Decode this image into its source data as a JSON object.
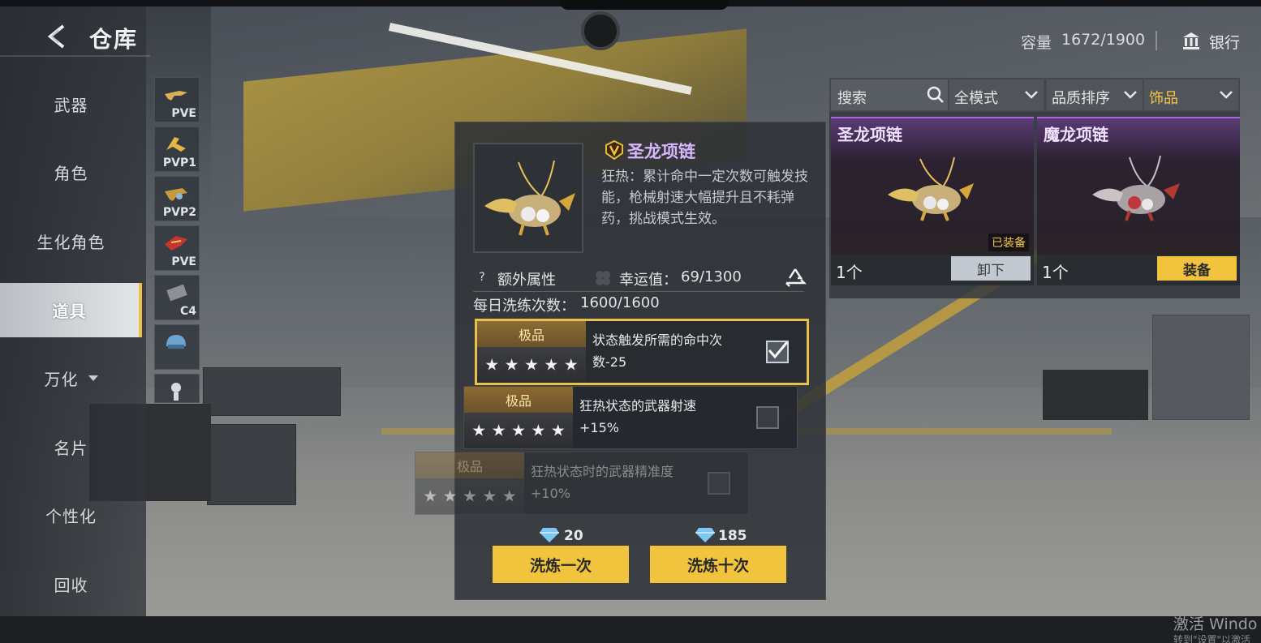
{
  "header": {
    "title": "仓库",
    "capacity_label": "容量",
    "capacity_value": "1672/1900",
    "bank_label": "银行"
  },
  "menu": {
    "items": [
      {
        "label": "武器"
      },
      {
        "label": "角色"
      },
      {
        "label": "生化角色"
      },
      {
        "label": "道具",
        "active": true
      },
      {
        "label": "万化",
        "has_caret": true
      },
      {
        "label": "名片"
      },
      {
        "label": "个性化"
      },
      {
        "label": "回收"
      }
    ]
  },
  "sub_tabs": [
    {
      "tag": "PVE",
      "icon": "weapon-pve-icon"
    },
    {
      "tag": "PVP1",
      "icon": "weapon-pvp1-icon"
    },
    {
      "tag": "PVP2",
      "icon": "weapon-pvp2-icon"
    },
    {
      "tag": "PVE",
      "icon": "red-weapon-pve-icon"
    },
    {
      "tag": "C4",
      "icon": "c4-icon"
    },
    {
      "tag": "",
      "icon": "helmet-icon"
    },
    {
      "tag": "",
      "icon": "skeleton-icon"
    }
  ],
  "filters": {
    "search_placeholder": "搜索",
    "mode": "全模式",
    "sort": "品质排序",
    "category": "饰品"
  },
  "inventory": [
    {
      "name": "圣龙项链",
      "qty": "1个",
      "equipped_badge": "已装备",
      "action": "卸下"
    },
    {
      "name": "魔龙项链",
      "qty": "1个",
      "action": "装备"
    }
  ],
  "detail": {
    "item_name": "圣龙项链",
    "description": "狂热：累计命中一定次数可触发技能，枪械射速大幅提升且不耗弹药，挑战模式生效。",
    "extra_label": "额外属性",
    "luck_label": "幸运值：",
    "luck_value": "69/1300",
    "daily_label": "每日洗练次数：",
    "daily_value": "1600/1600",
    "attributes": [
      {
        "tier": "极品",
        "stars": 5,
        "text": "状态触发所需的命中次数-25",
        "checked": true
      },
      {
        "tier": "极品",
        "stars": 5,
        "text": "狂热状态的武器射速+15%",
        "checked": false
      },
      {
        "tier": "极品",
        "stars": 5,
        "text": "狂热状态时的武器精准度+10%",
        "checked": false
      }
    ],
    "refine_once": {
      "cost": "20",
      "label": "洗炼一次"
    },
    "refine_ten": {
      "cost": "185",
      "label": "洗炼十次"
    }
  },
  "watermark": {
    "line1": "激活 Windo",
    "line2": "转到\"设置\"以激活"
  }
}
